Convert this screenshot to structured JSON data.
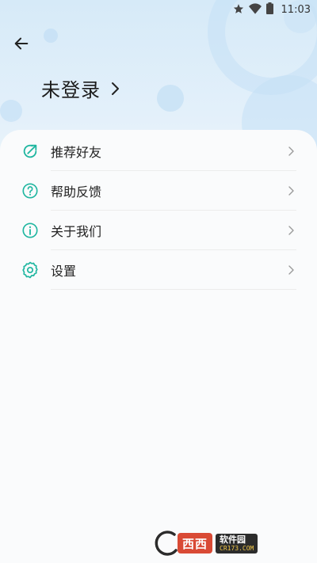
{
  "status_bar": {
    "time": "11:03",
    "icons": [
      "star-icon",
      "wifi-icon",
      "battery-icon"
    ]
  },
  "header": {
    "back_icon": "arrow-left-icon",
    "login_text": "未登录",
    "login_chevron": "chevron-right-icon"
  },
  "menu": {
    "items": [
      {
        "label": "推荐好友",
        "icon": "share-arrow-icon",
        "icon_color": "#1fb6a0"
      },
      {
        "label": "帮助反馈",
        "icon": "question-circle-icon",
        "icon_color": "#1fb6a0"
      },
      {
        "label": "关于我们",
        "icon": "info-circle-icon",
        "icon_color": "#1fb6a0"
      },
      {
        "label": "设置",
        "icon": "gear-icon",
        "icon_color": "#1fb6a0"
      }
    ]
  },
  "watermark": {
    "title": "西西",
    "name": "软件园",
    "url": "CR173.COM"
  },
  "colors": {
    "accent": "#1fb6a0",
    "header_bg": "#dcecf8",
    "card_bg": "#fafbfc"
  }
}
